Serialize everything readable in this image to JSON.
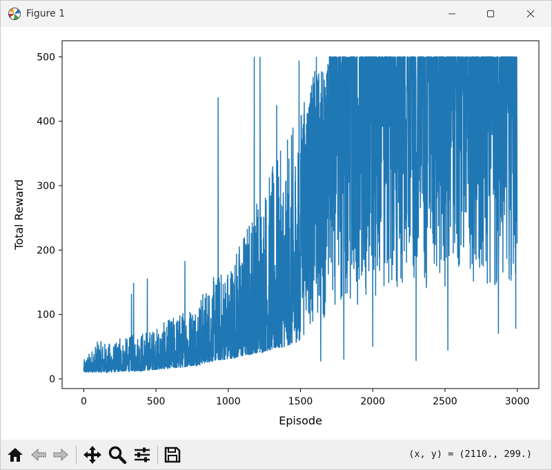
{
  "window": {
    "title": "Figure 1",
    "controls": [
      "minimize",
      "maximize",
      "close"
    ]
  },
  "toolbar": {
    "tools": [
      "home-icon",
      "back-icon",
      "forward-icon",
      "pan-icon",
      "zoom-icon",
      "configure-icon",
      "save-icon"
    ],
    "coords_text": "(x, y) = (2110., 299.)"
  },
  "colors": {
    "line": "#1f77b4",
    "axes": "#000000",
    "titlebar": "#f3f3f3",
    "toolbar": "#f0f0f0"
  },
  "chart_data": {
    "type": "line",
    "title": "",
    "xlabel": "Episode",
    "ylabel": "Total Reward",
    "xlim": [
      -150,
      3150
    ],
    "ylim": [
      -15,
      525
    ],
    "xticks": [
      0,
      500,
      1000,
      1500,
      2000,
      2500,
      3000
    ],
    "yticks": [
      0,
      100,
      200,
      300,
      400,
      500
    ],
    "grid": false,
    "legend": "none",
    "episodes": 3000,
    "series": [
      {
        "values_note_free": true,
        "envelope": [
          {
            "x": 0,
            "low": 10,
            "high": 30
          },
          {
            "x": 100,
            "low": 10,
            "high": 60
          },
          {
            "x": 200,
            "low": 10,
            "high": 55
          },
          {
            "x": 300,
            "low": 12,
            "high": 65
          },
          {
            "x": 400,
            "low": 12,
            "high": 75
          },
          {
            "x": 500,
            "low": 14,
            "high": 80
          },
          {
            "x": 600,
            "low": 16,
            "high": 95
          },
          {
            "x": 700,
            "low": 18,
            "high": 110
          },
          {
            "x": 800,
            "low": 22,
            "high": 130
          },
          {
            "x": 900,
            "low": 28,
            "high": 160
          },
          {
            "x": 1000,
            "low": 30,
            "high": 180
          },
          {
            "x": 1100,
            "low": 35,
            "high": 230
          },
          {
            "x": 1200,
            "low": 40,
            "high": 290
          },
          {
            "x": 1300,
            "low": 45,
            "high": 330
          },
          {
            "x": 1400,
            "low": 50,
            "high": 370
          },
          {
            "x": 1500,
            "low": 60,
            "high": 420
          },
          {
            "x": 1600,
            "low": 80,
            "high": 480
          },
          {
            "x": 1700,
            "low": 100,
            "high": 500
          },
          {
            "x": 1800,
            "low": 110,
            "high": 500
          },
          {
            "x": 2000,
            "low": 120,
            "high": 500
          },
          {
            "x": 2200,
            "low": 130,
            "high": 500
          },
          {
            "x": 2400,
            "low": 140,
            "high": 500
          },
          {
            "x": 2600,
            "low": 140,
            "high": 500
          },
          {
            "x": 2800,
            "low": 140,
            "high": 500
          },
          {
            "x": 3000,
            "low": 150,
            "high": 500
          }
        ],
        "spikes": [
          {
            "x": 250,
            "y": 63
          },
          {
            "x": 330,
            "y": 132
          },
          {
            "x": 345,
            "y": 149
          },
          {
            "x": 440,
            "y": 156
          },
          {
            "x": 700,
            "y": 183
          },
          {
            "x": 930,
            "y": 437
          },
          {
            "x": 1180,
            "y": 500
          },
          {
            "x": 1220,
            "y": 500
          },
          {
            "x": 1335,
            "y": 425
          },
          {
            "x": 1490,
            "y": 494
          },
          {
            "x": 1610,
            "y": 500
          }
        ],
        "dips": [
          {
            "x": 1640,
            "y": 27
          },
          {
            "x": 1800,
            "y": 30
          },
          {
            "x": 2000,
            "y": 50
          },
          {
            "x": 2300,
            "y": 28
          },
          {
            "x": 2520,
            "y": 44
          },
          {
            "x": 2870,
            "y": 70
          },
          {
            "x": 2990,
            "y": 78
          }
        ],
        "last_value": 210
      }
    ]
  }
}
